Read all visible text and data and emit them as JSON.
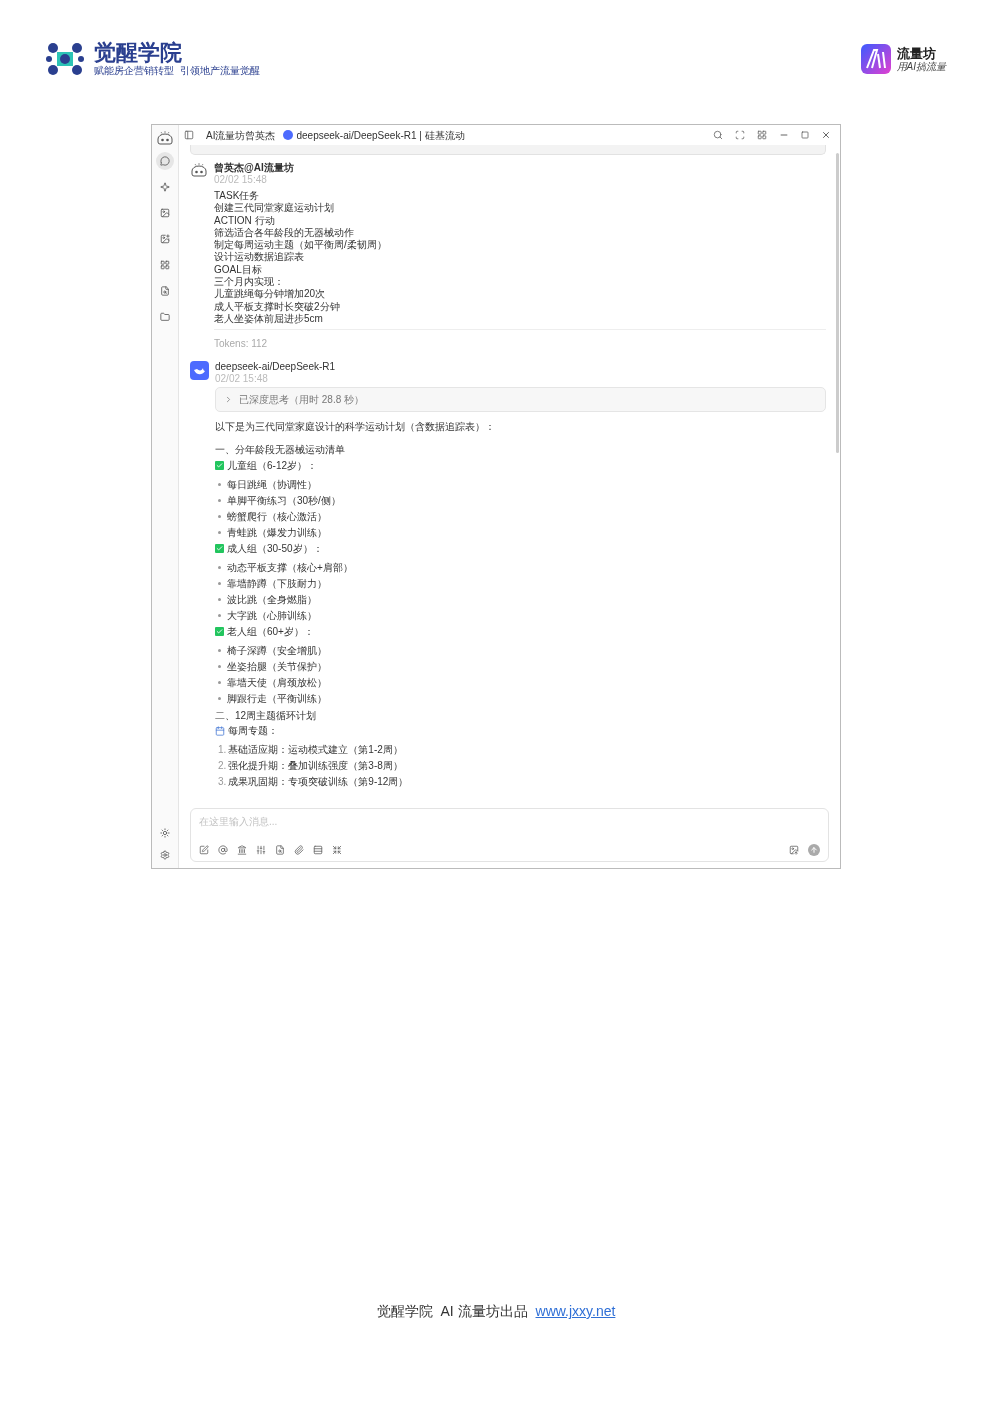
{
  "header": {
    "left_logo": {
      "title": "觉醒学院",
      "subtitle": "赋能房企营销转型  引领地产流量觉醒"
    },
    "right_logo": {
      "title": "流量坊",
      "subtitle": "用AI搞流量"
    }
  },
  "window": {
    "assistant_name": "AI流量坊曾英杰",
    "model": "deepseek-ai/DeepSeek-R1 | 硅基流动"
  },
  "sidebar": {
    "items": [
      {
        "kind": "chat",
        "selected": true
      },
      {
        "kind": "sparkle",
        "selected": false
      },
      {
        "kind": "image",
        "selected": false
      },
      {
        "kind": "image-plus",
        "selected": false
      },
      {
        "kind": "grid",
        "selected": false
      },
      {
        "kind": "doc-search",
        "selected": false
      },
      {
        "kind": "folder",
        "selected": false
      }
    ]
  },
  "messages": [
    {
      "kind": "user",
      "author": "曾英杰@AI流量坊",
      "time": "02/02 15:48",
      "lines": [
        "TASK任务",
        "创建三代同堂家庭运动计划",
        "ACTION 行动",
        "筛选适合各年龄段的无器械动作",
        "制定每周运动主题（如平衡周/柔韧周）",
        "设计运动数据追踪表",
        "GOAL目标",
        "三个月内实现：",
        "儿童跳绳每分钟增加20次",
        "成人平板支撑时长突破2分钟",
        "老人坐姿体前屈进步5cm"
      ],
      "tokens": "Tokens: 112"
    },
    {
      "kind": "assistant",
      "author": "deepseek-ai/DeepSeek-R1",
      "time": "02/02 15:48",
      "thinking": {
        "label": "已深度思考（用时 28.8 秒）",
        "expanded": false
      },
      "blocks": [
        {
          "kind": "paragraph",
          "text": "以下是为三代同堂家庭设计的科学运动计划（含数据追踪表）："
        },
        {
          "kind": "heading",
          "text": "一、分年龄段无器械运动清单"
        },
        {
          "kind": "check",
          "text": "儿童组（6-12岁）："
        },
        {
          "kind": "bullet",
          "text": "每日跳绳（协调性）"
        },
        {
          "kind": "bullet",
          "text": "单脚平衡练习（30秒/侧）"
        },
        {
          "kind": "bullet",
          "text": "螃蟹爬行（核心激活）"
        },
        {
          "kind": "bullet",
          "text": "青蛙跳（爆发力训练）"
        },
        {
          "kind": "check",
          "text": "成人组（30-50岁）："
        },
        {
          "kind": "bullet",
          "text": "动态平板支撑（核心+肩部）"
        },
        {
          "kind": "bullet",
          "text": "靠墙静蹲（下肢耐力）"
        },
        {
          "kind": "bullet",
          "text": "波比跳（全身燃脂）"
        },
        {
          "kind": "bullet",
          "text": "大字跳（心肺训练）"
        },
        {
          "kind": "check",
          "text": "老人组（60+岁）："
        },
        {
          "kind": "bullet",
          "text": "椅子深蹲（安全增肌）"
        },
        {
          "kind": "bullet",
          "text": "坐姿抬腿（关节保护）"
        },
        {
          "kind": "bullet",
          "text": "靠墙天使（肩颈放松）"
        },
        {
          "kind": "bullet",
          "text": "脚跟行走（平衡训练）"
        },
        {
          "kind": "heading",
          "text": "二、12周主题循环计划"
        },
        {
          "kind": "calendar",
          "text": "每周专题："
        },
        {
          "kind": "numbered",
          "num": "1.",
          "text": "基础适应期：运动模式建立（第1-2周）"
        },
        {
          "kind": "numbered",
          "num": "2.",
          "text": "强化提升期：叠加训练强度（第3-8周）"
        },
        {
          "kind": "numbered",
          "num": "3.",
          "text": "成果巩固期：专项突破训练（第9-12周）"
        }
      ]
    }
  ],
  "input": {
    "placeholder": "在这里输入消息..."
  },
  "footer": {
    "text": "觉醒学院  AI 流量坊出品",
    "link": "www.jxxy.net"
  }
}
